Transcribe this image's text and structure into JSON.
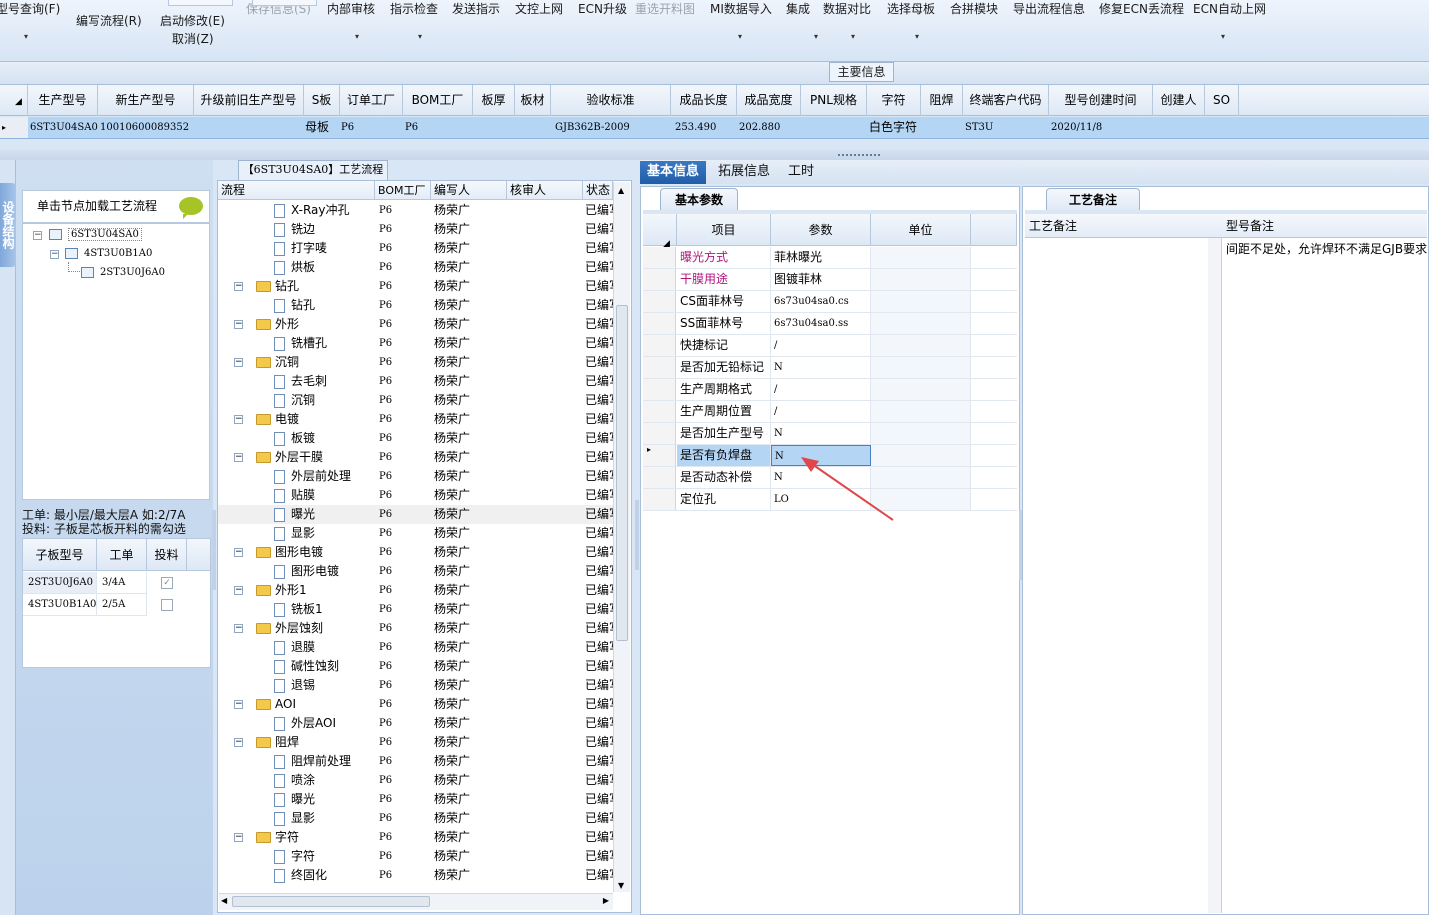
{
  "toolbar": {
    "items": [
      {
        "label": "型号查询(F)",
        "dis": false
      },
      {
        "label": "编写流程(R)",
        "dis": false
      },
      {
        "label": "启动修改(E)",
        "sub": "取消(Z)",
        "dis": false
      },
      {
        "label": "保存信息(S)",
        "dis": true
      },
      {
        "label": "内部审核",
        "dis": false
      },
      {
        "label": "指示检查",
        "dis": false
      },
      {
        "label": "发送指示",
        "dis": false
      },
      {
        "label": "文控上网",
        "dis": false
      },
      {
        "label": "ECN升级",
        "dis": false
      },
      {
        "label": "重选开料图",
        "dis": true
      },
      {
        "label": "MI数据导入",
        "dis": false
      },
      {
        "label": "集成",
        "dis": false
      },
      {
        "label": "数据对比",
        "dis": false
      },
      {
        "label": "选择母板",
        "dis": false
      },
      {
        "label": "合拼模块",
        "dis": false
      },
      {
        "label": "导出流程信息",
        "dis": false
      },
      {
        "label": "修复ECN丢流程",
        "dis": false
      },
      {
        "label": "ECN自动上网",
        "dis": false
      }
    ]
  },
  "main_info": {
    "title": "主要信息",
    "headers": [
      "生产型号",
      "新生产型号",
      "升级前旧生产型号",
      "S板",
      "订单工厂",
      "BOM工厂",
      "板厚",
      "板材",
      "验收标准",
      "成品长度",
      "成品宽度",
      "PNL规格",
      "字符",
      "阻焊",
      "终端客户代码",
      "型号创建时间",
      "创建人",
      "SO"
    ],
    "row": [
      "6ST3U04SA0",
      "10010600089352",
      "",
      "母板",
      "P6",
      "P6",
      "",
      "",
      "GJB362B-2009",
      "253.490",
      "202.880",
      "",
      "白色字符",
      "",
      "ST3U",
      "2020/11/8",
      "",
      ""
    ]
  },
  "left": {
    "vertical_tab": "设备结构",
    "hint": "单击节点加载工艺流程",
    "tree": [
      "6ST3U04SA0",
      "4ST3U0B1A0",
      "2ST3U0J6A0"
    ],
    "note_line1": "工单: 最小层/最大层A 如:2/7A",
    "note_line2": "投料: 子板是芯板开料的需勾选",
    "sub_headers": [
      "子板型号",
      "工单",
      "投料"
    ],
    "sub_rows": [
      {
        "model": "2ST3U0J6A0",
        "order": "3/4A",
        "checked": true
      },
      {
        "model": "4ST3U0B1A0",
        "order": "2/5A",
        "checked": false
      }
    ]
  },
  "process": {
    "tab": "【6ST3U04SA0】工艺流程",
    "headers": [
      "流程",
      "BOM工厂",
      "编写人",
      "核审人",
      "状态"
    ],
    "rows": [
      {
        "name": "X-Ray冲孔",
        "lvl": 2,
        "factory": "P6",
        "writer": "杨荣广",
        "status": "已编写"
      },
      {
        "name": "铣边",
        "lvl": 2,
        "factory": "P6",
        "writer": "杨荣广",
        "status": "已编写"
      },
      {
        "name": "打字唛",
        "lvl": 2,
        "factory": "P6",
        "writer": "杨荣广",
        "status": "已编写"
      },
      {
        "name": "烘板",
        "lvl": 2,
        "factory": "P6",
        "writer": "杨荣广",
        "status": "已编写"
      },
      {
        "name": "钻孔",
        "lvl": 1,
        "factory": "P6",
        "writer": "杨荣广",
        "status": "已编写"
      },
      {
        "name": "钻孔",
        "lvl": 2,
        "factory": "P6",
        "writer": "杨荣广",
        "status": "已编写"
      },
      {
        "name": "外形",
        "lvl": 1,
        "factory": "P6",
        "writer": "杨荣广",
        "status": "已编写"
      },
      {
        "name": "铣槽孔",
        "lvl": 2,
        "factory": "P6",
        "writer": "杨荣广",
        "status": "已编写"
      },
      {
        "name": "沉铜",
        "lvl": 1,
        "factory": "P6",
        "writer": "杨荣广",
        "status": "已编写"
      },
      {
        "name": "去毛刺",
        "lvl": 2,
        "factory": "P6",
        "writer": "杨荣广",
        "status": "已编写"
      },
      {
        "name": "沉铜",
        "lvl": 2,
        "factory": "P6",
        "writer": "杨荣广",
        "status": "已编写"
      },
      {
        "name": "电镀",
        "lvl": 1,
        "factory": "P6",
        "writer": "杨荣广",
        "status": "已编写"
      },
      {
        "name": "板镀",
        "lvl": 2,
        "factory": "P6",
        "writer": "杨荣广",
        "status": "已编写"
      },
      {
        "name": "外层干膜",
        "lvl": 1,
        "factory": "P6",
        "writer": "杨荣广",
        "status": "已编写"
      },
      {
        "name": "外层前处理",
        "lvl": 2,
        "factory": "P6",
        "writer": "杨荣广",
        "status": "已编写"
      },
      {
        "name": "贴膜",
        "lvl": 2,
        "factory": "P6",
        "writer": "杨荣广",
        "status": "已编写"
      },
      {
        "name": "曝光",
        "lvl": 2,
        "factory": "P6",
        "writer": "杨荣广",
        "status": "已编写",
        "sel": true
      },
      {
        "name": "显影",
        "lvl": 2,
        "factory": "P6",
        "writer": "杨荣广",
        "status": "已编写"
      },
      {
        "name": "图形电镀",
        "lvl": 1,
        "factory": "P6",
        "writer": "杨荣广",
        "status": "已编写"
      },
      {
        "name": "图形电镀",
        "lvl": 2,
        "factory": "P6",
        "writer": "杨荣广",
        "status": "已编写"
      },
      {
        "name": "外形1",
        "lvl": 1,
        "factory": "P6",
        "writer": "杨荣广",
        "status": "已编写"
      },
      {
        "name": "铣板1",
        "lvl": 2,
        "factory": "P6",
        "writer": "杨荣广",
        "status": "已编写"
      },
      {
        "name": "外层蚀刻",
        "lvl": 1,
        "factory": "P6",
        "writer": "杨荣广",
        "status": "已编写"
      },
      {
        "name": "退膜",
        "lvl": 2,
        "factory": "P6",
        "writer": "杨荣广",
        "status": "已编写"
      },
      {
        "name": "碱性蚀刻",
        "lvl": 2,
        "factory": "P6",
        "writer": "杨荣广",
        "status": "已编写"
      },
      {
        "name": "退锡",
        "lvl": 2,
        "factory": "P6",
        "writer": "杨荣广",
        "status": "已编写"
      },
      {
        "name": "AOI",
        "lvl": 1,
        "factory": "P6",
        "writer": "杨荣广",
        "status": "已编写"
      },
      {
        "name": "外层AOI",
        "lvl": 2,
        "factory": "P6",
        "writer": "杨荣广",
        "status": "已编写"
      },
      {
        "name": "阻焊",
        "lvl": 1,
        "factory": "P6",
        "writer": "杨荣广",
        "status": "已编写"
      },
      {
        "name": "阻焊前处理",
        "lvl": 2,
        "factory": "P6",
        "writer": "杨荣广",
        "status": "已编写"
      },
      {
        "name": "喷涂",
        "lvl": 2,
        "factory": "P6",
        "writer": "杨荣广",
        "status": "已编写"
      },
      {
        "name": "曝光",
        "lvl": 2,
        "factory": "P6",
        "writer": "杨荣广",
        "status": "已编写"
      },
      {
        "name": "显影",
        "lvl": 2,
        "factory": "P6",
        "writer": "杨荣广",
        "status": "已编写"
      },
      {
        "name": "字符",
        "lvl": 1,
        "factory": "P6",
        "writer": "杨荣广",
        "status": "已编写"
      },
      {
        "name": "字符",
        "lvl": 2,
        "factory": "P6",
        "writer": "杨荣广",
        "status": "已编写"
      },
      {
        "name": "终固化",
        "lvl": 2,
        "factory": "P6",
        "writer": "杨荣广",
        "status": "已编写"
      }
    ]
  },
  "right": {
    "tabs": [
      "基本信息",
      "拓展信息",
      "工时"
    ],
    "basic_tab": "基本参数",
    "headers": [
      "项目",
      "参数",
      "单位"
    ],
    "rows": [
      {
        "item": "曝光方式",
        "value": "菲林曝光",
        "color": "#b0157e",
        "code": false
      },
      {
        "item": "干膜用途",
        "value": "图镀菲林",
        "color": "#b0157e",
        "code": false
      },
      {
        "item": "CS面菲林号",
        "value": "6s73u04sa0.cs",
        "color": "#000000",
        "code": true
      },
      {
        "item": "SS面菲林号",
        "value": "6s73u04sa0.ss",
        "color": "#000000",
        "code": true
      },
      {
        "item": "快捷标记",
        "value": "/",
        "color": "#000000",
        "code": true
      },
      {
        "item": "是否加无铅标记",
        "value": "N",
        "color": "#000000",
        "code": true
      },
      {
        "item": "生产周期格式",
        "value": "/",
        "color": "#000000",
        "code": true
      },
      {
        "item": "生产周期位置",
        "value": "/",
        "color": "#000000",
        "code": true
      },
      {
        "item": "是否加生产型号",
        "value": "N",
        "color": "#000000",
        "code": true
      },
      {
        "item": "是否有负焊盘",
        "value": "N",
        "color": "#000000",
        "code": true,
        "sel": true
      },
      {
        "item": "是否动态补偿",
        "value": "N",
        "color": "#000000",
        "code": true
      },
      {
        "item": "定位孔",
        "value": "LO",
        "color": "#000000",
        "code": true
      }
    ],
    "remark_tab": "工艺备注",
    "remark_headers": [
      "工艺备注",
      "型号备注"
    ],
    "model_remark": "间距不足处，允许焊环不满足GJB要求"
  },
  "colors": {
    "accent": "#2a66b3",
    "arrow": "#e0464b",
    "selection": "#b5d5f5"
  }
}
